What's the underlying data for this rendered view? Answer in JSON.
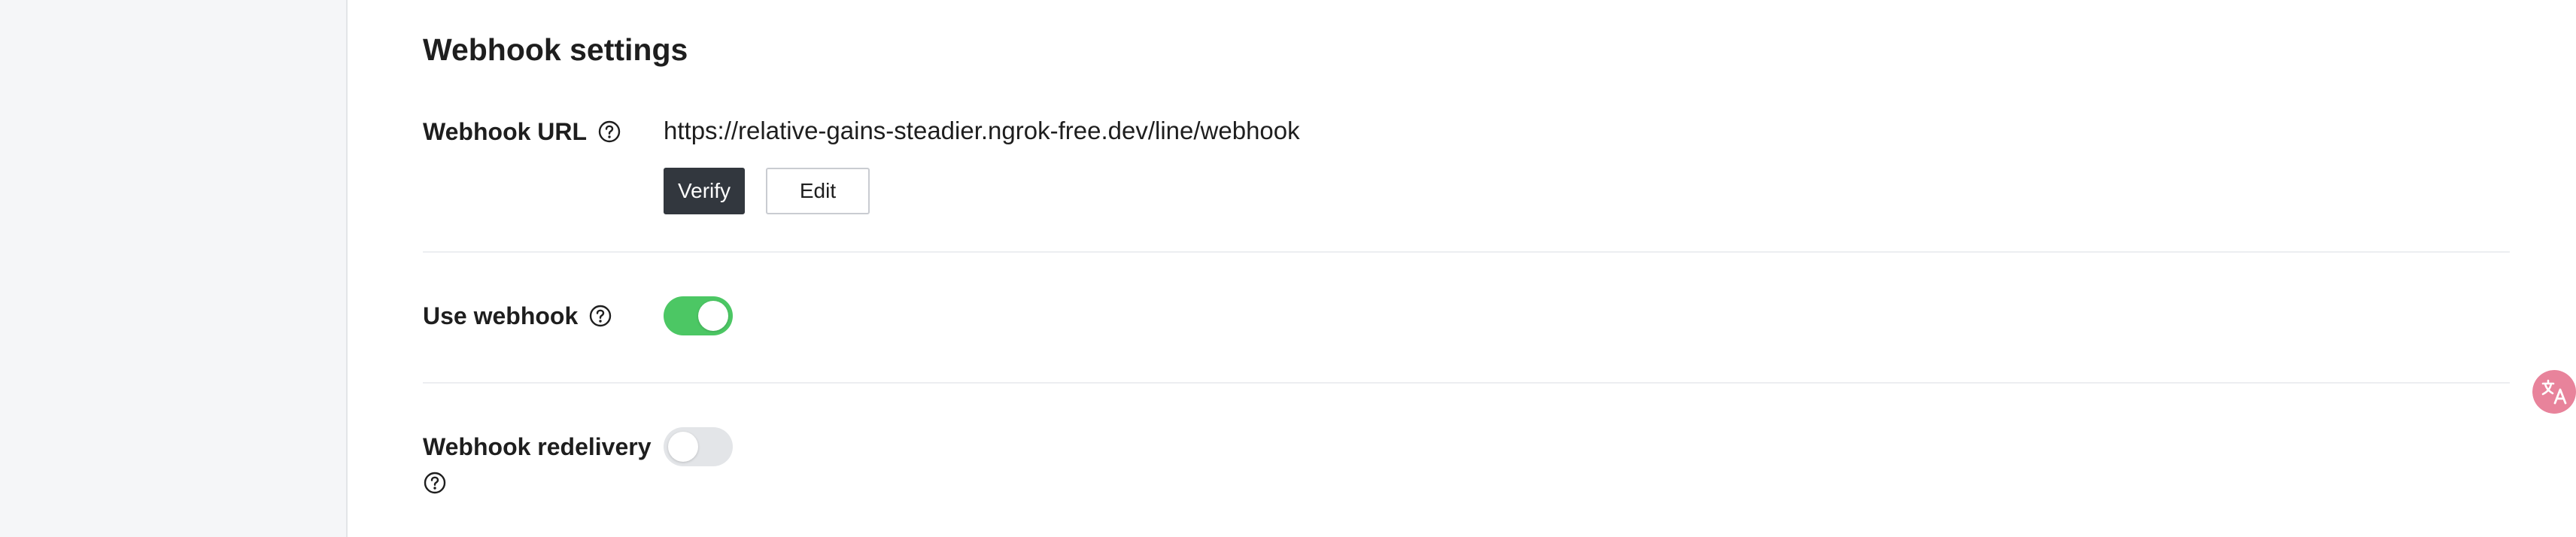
{
  "section": {
    "title": "Webhook settings"
  },
  "webhook_url": {
    "label": "Webhook URL",
    "value": "https://relative-gains-steadier.ngrok-free.dev/line/webhook",
    "verify_label": "Verify",
    "edit_label": "Edit"
  },
  "use_webhook": {
    "label": "Use webhook",
    "enabled": true
  },
  "webhook_redelivery": {
    "label": "Webhook redelivery",
    "enabled": false
  },
  "colors": {
    "toggle_on": "#4cc764",
    "toggle_off": "#e3e5e8",
    "verify_button": "#32373e",
    "translate_fab": "#e8839b"
  },
  "icons": {
    "help": "question-circle-icon",
    "translate": "translate-icon"
  }
}
